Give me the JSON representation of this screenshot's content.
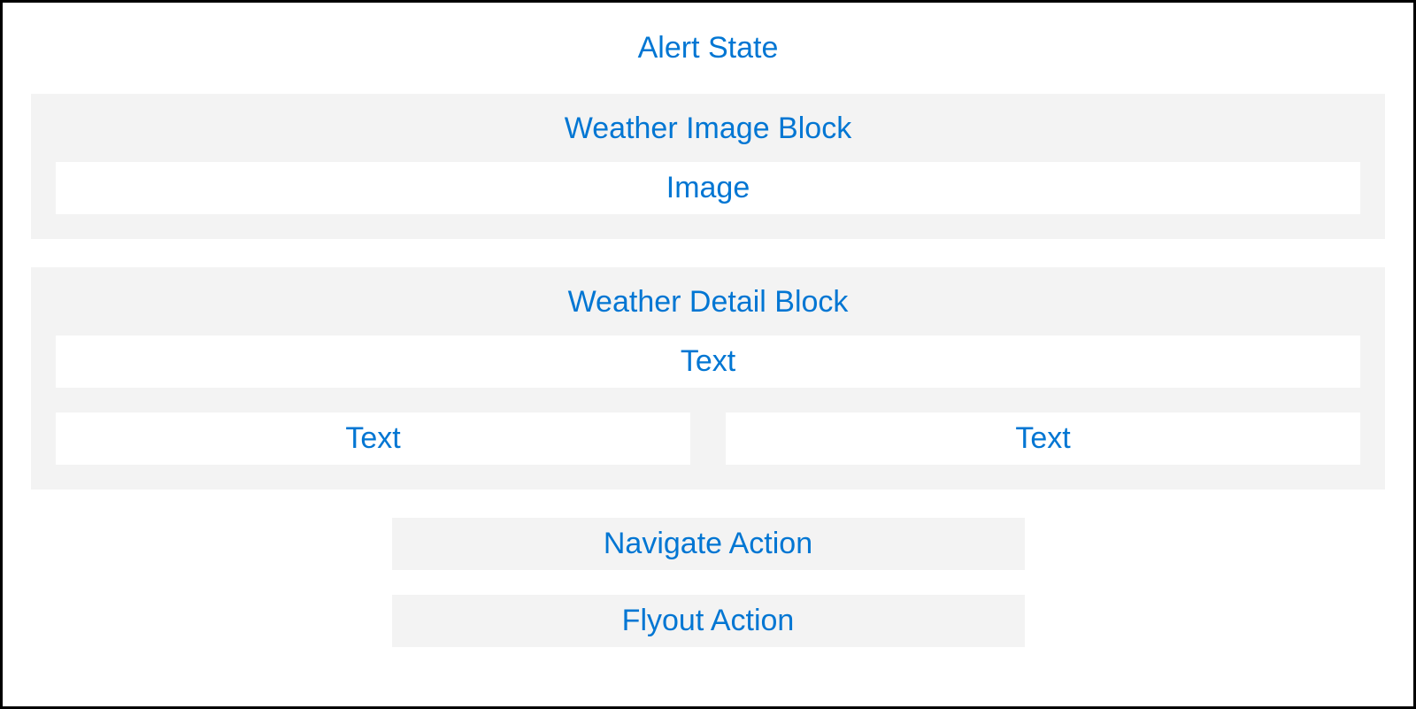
{
  "title": "Alert State",
  "blocks": {
    "weatherImage": {
      "title": "Weather Image Block",
      "item": "Image"
    },
    "weatherDetail": {
      "title": "Weather Detail Block",
      "item1": "Text",
      "item2": "Text",
      "item3": "Text"
    }
  },
  "actions": {
    "navigate": "Navigate Action",
    "flyout": "Flyout Action"
  }
}
